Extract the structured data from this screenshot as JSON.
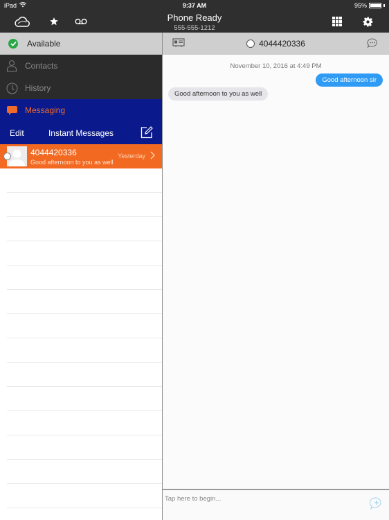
{
  "status_bar": {
    "device": "iPad",
    "time": "9:37 AM",
    "battery_text": "95%",
    "battery_level": 0.95
  },
  "header": {
    "title": "Phone Ready",
    "subtitle": "555-555-1212",
    "left_icons": [
      "cloud-icon",
      "star-icon",
      "voicemail-icon"
    ],
    "right_icons": [
      "dialpad-icon",
      "gear-icon"
    ]
  },
  "presence": {
    "label": "Available",
    "color": "#29a745"
  },
  "nav": {
    "items": [
      {
        "label": "Contacts",
        "icon": "person-icon"
      },
      {
        "label": "History",
        "icon": "clock-icon"
      },
      {
        "label": "Messaging",
        "icon": "chat-bubble-icon",
        "active": true
      }
    ]
  },
  "messages_list": {
    "edit_label": "Edit",
    "title": "Instant Messages",
    "conversations": [
      {
        "name": "4044420336",
        "preview": "Good afternoon to you as well",
        "when": "Yesterday"
      }
    ]
  },
  "chat": {
    "contact": "4044420336",
    "timestamp": "November 10, 2016 at 4:49 PM",
    "messages": [
      {
        "direction": "outgoing",
        "text": "Good afternoon sir"
      },
      {
        "direction": "incoming",
        "text": "Good afternoon to you as well"
      }
    ],
    "composer_placeholder": "Tap here to begin...",
    "composer_value": ""
  },
  "colors": {
    "header_bg": "#2f2f2f",
    "nav_dark": "#2b2b2b",
    "nav_blue": "#0a1a8c",
    "accent_orange": "#f26a22",
    "outgoing_bubble": "#2f9bf4",
    "incoming_bubble": "#e6e6ea"
  }
}
